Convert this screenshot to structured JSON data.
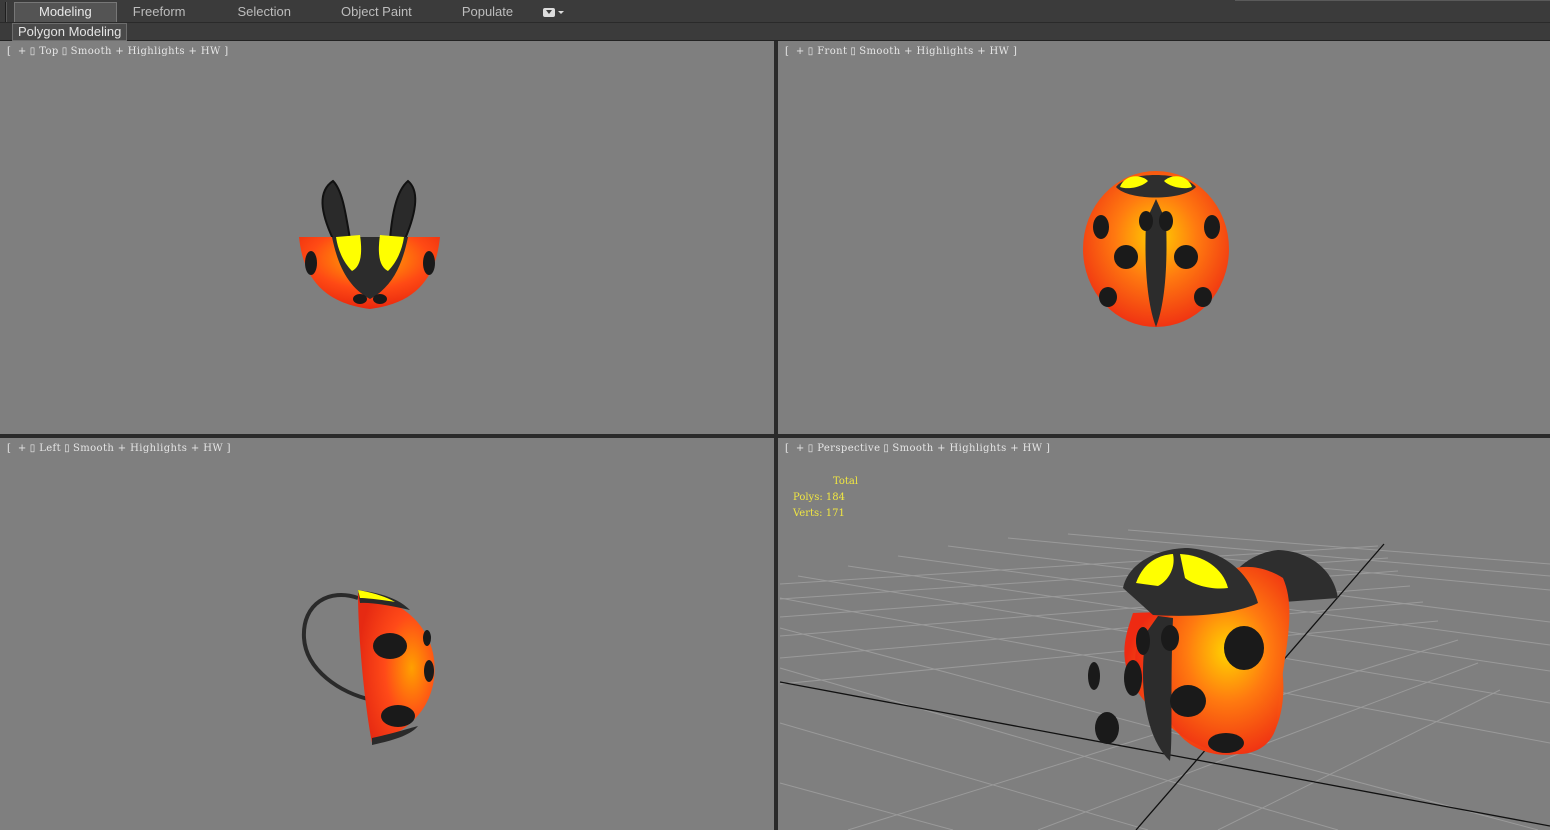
{
  "ribbon": {
    "tabs": [
      "Modeling",
      "Freeform",
      "Selection",
      "Object Paint",
      "Populate"
    ],
    "active_tab": "Modeling",
    "sub_panel": "Polygon Modeling"
  },
  "viewports": {
    "top": {
      "bracket_open": "[",
      "plus": "+",
      "name": "Top",
      "shading": "Smooth + Highlights + HW",
      "bracket_close": "]"
    },
    "front": {
      "bracket_open": "[",
      "plus": "+",
      "name": "Front",
      "shading": "Smooth + Highlights + HW",
      "bracket_close": "]"
    },
    "left": {
      "bracket_open": "[",
      "plus": "+",
      "name": "Left",
      "shading": "Smooth + Highlights + HW",
      "bracket_close": "]"
    },
    "perspective": {
      "bracket_open": "[",
      "plus": "+",
      "name": "Perspective",
      "shading": "Smooth + Highlights + HW",
      "bracket_close": "]"
    }
  },
  "stats": {
    "total_label": "Total",
    "polys_label": "Polys:",
    "polys_value": "184",
    "verts_label": "Verts:",
    "verts_value": "171"
  },
  "colors": {
    "viewport_bg": "#7f7f7f",
    "stats_text": "#f0e642",
    "ladybug_red": "#ff3a1a",
    "ladybug_orange": "#ffb400",
    "ladybug_yellow": "#ffff00",
    "spots": "#1a1a1a"
  },
  "icons": [
    "menu-dropdown-icon"
  ]
}
